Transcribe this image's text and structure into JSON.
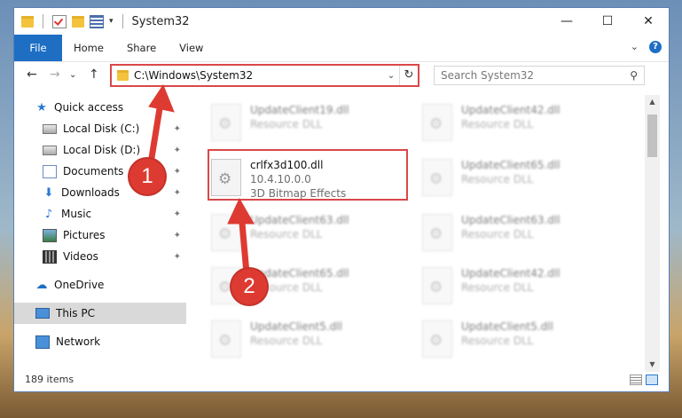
{
  "window": {
    "title": "System32",
    "controls": {
      "minimize": "—",
      "maximize": "☐",
      "close": "✕"
    }
  },
  "ribbon": {
    "tabs": [
      "File",
      "Home",
      "Share",
      "View"
    ],
    "expand": "⌄",
    "help": "?"
  },
  "navigation": {
    "back": "←",
    "forward": "→",
    "recent": "⌄",
    "up": "↑",
    "address": "C:\\Windows\\System32",
    "refresh": "↻",
    "search_placeholder": "Search System32"
  },
  "sidebar": {
    "items": [
      {
        "label": "Quick access",
        "icon": "star-icon"
      },
      {
        "label": "Local Disk (C:)",
        "icon": "drive-icon",
        "pinned": true
      },
      {
        "label": "Local Disk (D:)",
        "icon": "drive-icon",
        "pinned": true
      },
      {
        "label": "Documents",
        "icon": "documents-icon",
        "pinned": true
      },
      {
        "label": "Downloads",
        "icon": "download-icon",
        "pinned": true
      },
      {
        "label": "Music",
        "icon": "music-icon",
        "pinned": true
      },
      {
        "label": "Pictures",
        "icon": "pictures-icon",
        "pinned": true
      },
      {
        "label": "Videos",
        "icon": "videos-icon",
        "pinned": true
      },
      {
        "label": "OneDrive",
        "icon": "cloud-icon"
      },
      {
        "label": "This PC",
        "icon": "computer-icon",
        "selected": true
      },
      {
        "label": "Network",
        "icon": "network-icon"
      }
    ],
    "pin_glyph": "📌"
  },
  "files": [
    {
      "name": "UpdateClient19.dll",
      "type": "Resource DLL"
    },
    {
      "name": "UpdateClient42.dll",
      "type": "Resource DLL"
    },
    {
      "name": "crlfx3d100.dll",
      "version": "10.4.10.0.0",
      "description": "3D Bitmap Effects"
    },
    {
      "name": "UpdateClient65.dll",
      "type": "Resource DLL"
    },
    {
      "name": "UpdateClient63.dll",
      "type": "Resource DLL"
    },
    {
      "name": "UpdateClient63.dll",
      "type": "Resource DLL"
    },
    {
      "name": "UpdateClient65.dll",
      "type": "Resource DLL"
    },
    {
      "name": "UpdateClient42.dll",
      "type": "Resource DLL"
    },
    {
      "name": "UpdateClient5.dll",
      "type": "Resource DLL"
    },
    {
      "name": "UpdateClient5.dll",
      "type": "Resource DLL"
    }
  ],
  "status": {
    "item_count": "189 items"
  },
  "annotations": {
    "step1": "1",
    "step2": "2",
    "color": "#dd3b32"
  }
}
